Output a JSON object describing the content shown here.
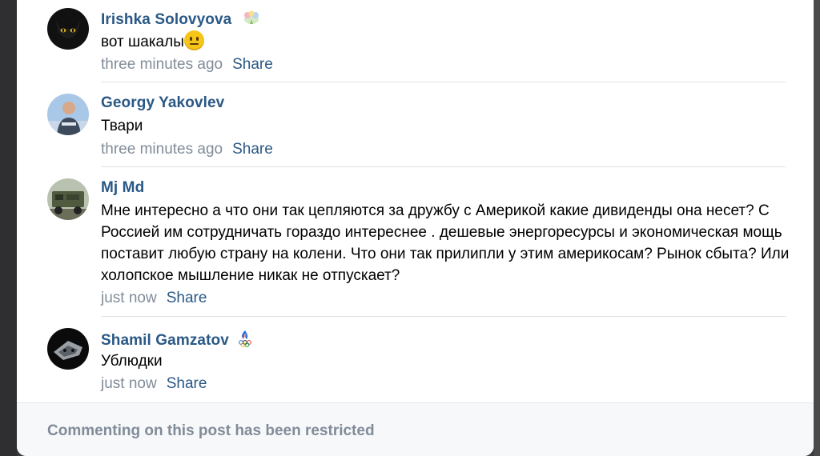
{
  "comments": [
    {
      "author": "Irishka Solovyova",
      "text": "вот шакалы",
      "time": "three minutes ago",
      "share": "Share",
      "badge_icon": "flowers-gift-icon",
      "emoji": "neutral-face-emoji"
    },
    {
      "author": "Georgy Yakovlev",
      "text": "Твари",
      "time": "three minutes ago",
      "share": "Share"
    },
    {
      "author": "Mj Md",
      "text": "Мне интересно а что они так цепляются за дружбу с Америкой какие дивиденды она несет? С Россией им сотрудничать гораздо интереснее . дешевые энергоресурсы и экономическая мощь поставит любую страну на колени. Что они так прилипли у этим америкосам? Рынок сбыта? Или холопское мышление никак не отпускает?",
      "time": "just now",
      "share": "Share"
    },
    {
      "author": "Shamil Gamzatov",
      "text": "Ублюдки",
      "time": "just now",
      "share": "Share",
      "badge_icon": "olympic-flame-icon"
    }
  ],
  "footer": {
    "restricted_text": "Commenting on this post has been restricted"
  },
  "colors": {
    "link": "#2a5885",
    "muted": "#818c99",
    "divider": "#dce1e6"
  }
}
